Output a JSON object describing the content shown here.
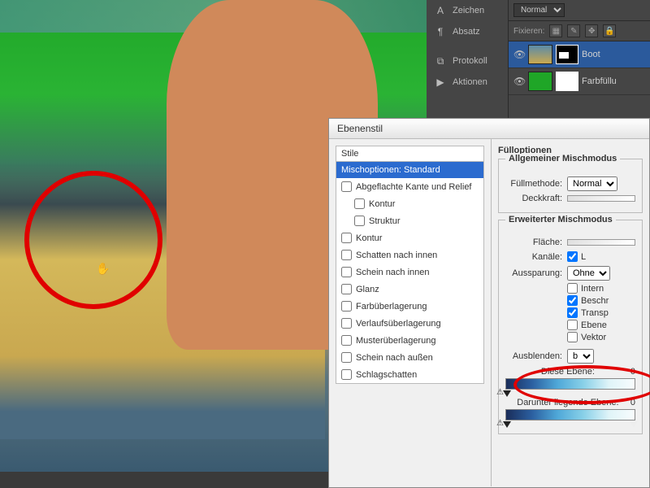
{
  "panels": {
    "items": [
      {
        "icon": "A",
        "label": "Zeichen"
      },
      {
        "icon": "¶",
        "label": "Absatz"
      },
      {
        "icon": "≡",
        "label": "Protokoll"
      },
      {
        "icon": "▶",
        "label": "Aktionen"
      }
    ]
  },
  "layers": {
    "blend_mode": "Normal",
    "lock_label": "Fixieren:",
    "items": [
      {
        "name": "Boot",
        "thumb_bg": "#4a7a90",
        "mask_bg": "#0a0a0a",
        "mask_fg": "#fff",
        "selected": true
      },
      {
        "name": "Farbfüllu",
        "thumb_bg": "#1fa627",
        "mask_bg": "#fff",
        "mask_fg": "#fff",
        "selected": false
      }
    ]
  },
  "dialog": {
    "title": "Ebenenstil",
    "styles_header": "Stile",
    "styles": [
      {
        "label": "Mischoptionen: Standard",
        "selected": true,
        "checkbox": false
      },
      {
        "label": "Abgeflachte Kante und Relief",
        "checkbox": true
      },
      {
        "label": "Kontur",
        "checkbox": true,
        "sub": true
      },
      {
        "label": "Struktur",
        "checkbox": true,
        "sub": true
      },
      {
        "label": "Kontur",
        "checkbox": true
      },
      {
        "label": "Schatten nach innen",
        "checkbox": true
      },
      {
        "label": "Schein nach innen",
        "checkbox": true
      },
      {
        "label": "Glanz",
        "checkbox": true
      },
      {
        "label": "Farbüberlagerung",
        "checkbox": true
      },
      {
        "label": "Verlaufsüberlagerung",
        "checkbox": true
      },
      {
        "label": "Musterüberlagerung",
        "checkbox": true
      },
      {
        "label": "Schein nach außen",
        "checkbox": true
      },
      {
        "label": "Schlagschatten",
        "checkbox": true
      }
    ],
    "opts": {
      "fill_options": "Fülloptionen",
      "general_mode": "Allgemeiner Mischmodus",
      "blend_method_label": "Füllmethode:",
      "blend_method": "Normal",
      "opacity_label": "Deckkraft:",
      "adv_mode": "Erweiterter Mischmodus",
      "fill_label": "Fläche:",
      "channels_label": "Kanäle:",
      "channels": [
        "L"
      ],
      "knockout_label": "Aussparung:",
      "knockout": "Ohne",
      "checks": [
        "Intern",
        "Beschr",
        "Transp",
        "Ebene",
        "Vektor"
      ],
      "checks_on": [
        false,
        true,
        true,
        false,
        false
      ],
      "blend_if_label": "Ausblenden:",
      "blend_if": "b",
      "this_layer_label": "Diese Ebene:",
      "this_layer_val": "0",
      "under_layer_label": "Darunter liegende Ebene:",
      "under_layer_val": "0"
    }
  }
}
